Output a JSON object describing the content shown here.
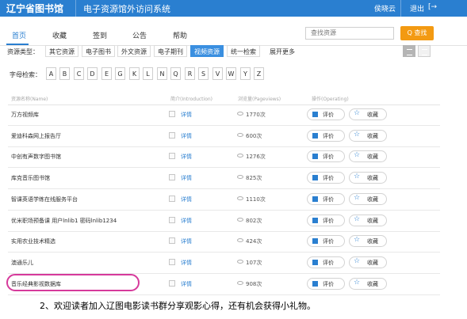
{
  "header": {
    "site_name": "辽宁省图书馆",
    "system_name": "电子资源馆外访问系统",
    "user": "侯晓云",
    "logout": "退出",
    "logout_icon": "[→"
  },
  "nav": {
    "items": [
      {
        "label": "首页"
      },
      {
        "label": "收藏"
      },
      {
        "label": "签到"
      },
      {
        "label": "公告"
      },
      {
        "label": "帮助"
      }
    ],
    "search_placeholder": "查找资源",
    "search_button": "Q 查找"
  },
  "resource_types": {
    "label": "资源类型：",
    "tags": [
      "其它资源",
      "电子图书",
      "外文资源",
      "电子期刊",
      "视频资源",
      "统一检索"
    ],
    "selected": "视频资源",
    "expand": "展开更多"
  },
  "letter_index": {
    "label": "字母检索：",
    "letters": [
      "A",
      "B",
      "C",
      "D",
      "E",
      "G",
      "K",
      "L",
      "N",
      "Q",
      "R",
      "S",
      "V",
      "W",
      "Y",
      "Z"
    ]
  },
  "table": {
    "headers": [
      "资源名称(Name)",
      "简介(Introduction)",
      "浏览量(Pageviews)",
      "操作(Operating)"
    ],
    "intro_label": "详情",
    "review_label": "评价",
    "fav_label": "收藏",
    "rows": [
      {
        "name": "万方视频库",
        "views": "1770次"
      },
      {
        "name": "爱迪科森网上报告厅",
        "views": "600次"
      },
      {
        "name": "中创有声数字图书馆",
        "views": "1276次"
      },
      {
        "name": "库克音乐图书馆",
        "views": "825次"
      },
      {
        "name": "智课英语学练在线服务平台",
        "views": "1110次"
      },
      {
        "name": "优米职场预备课 用户lnlib1 密码lnlib1234",
        "views": "802次"
      },
      {
        "name": "实用农业技术精选",
        "views": "424次"
      },
      {
        "name": "澳通乐儿",
        "views": "107次"
      },
      {
        "name": "音乐经典影视数据库",
        "views": "908次"
      }
    ]
  },
  "caption": "2、欢迎读者加入辽图电影读书群分享观影心得，还有机会获得小礼物。",
  "colors": {
    "primary": "#2a7fd0",
    "search_button": "#f39a12",
    "highlight_circle": "#d63a9b"
  }
}
